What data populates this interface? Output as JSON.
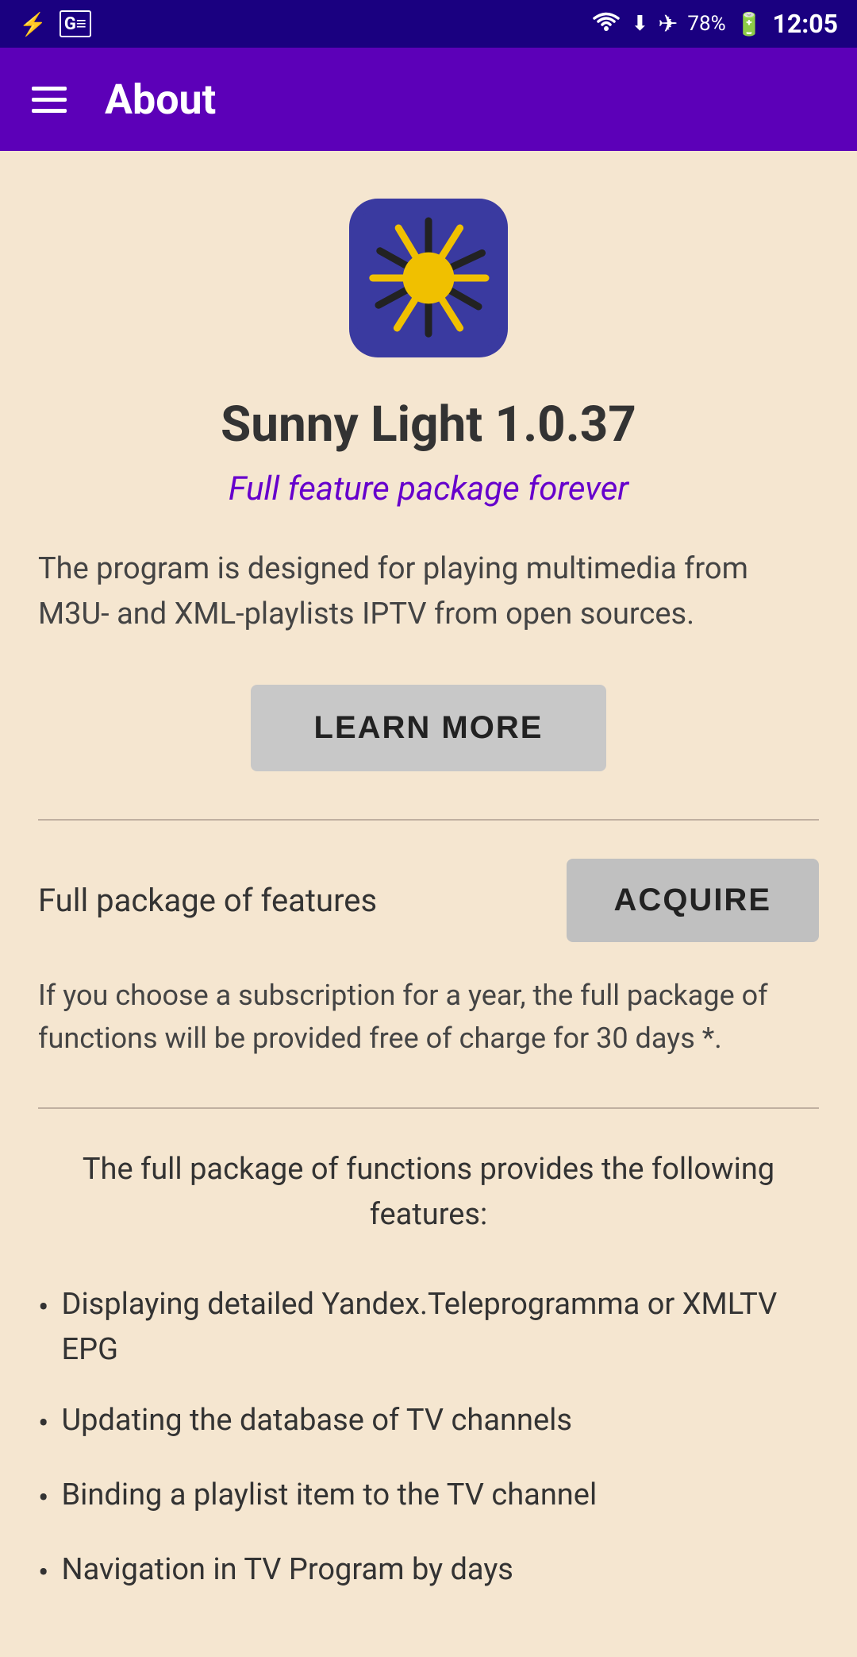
{
  "statusBar": {
    "time": "12:05",
    "battery": "78%",
    "icons": {
      "usb": "⚡",
      "news": "G≡",
      "wifi": "📶",
      "airplane": "✈",
      "charging": "🔋"
    }
  },
  "toolbar": {
    "title": "About",
    "menu_icon": "menu"
  },
  "app": {
    "name": "Sunny Light 1.0.37",
    "tagline": "Full feature package forever",
    "description": "The program is designed for playing multimedia from M3U- and XML-playlists IPTV from open sources.",
    "learn_more_label": "LEARN MORE",
    "acquire_label": "Full package of features",
    "acquire_button": "ACQUIRE",
    "subscription_text": "If you choose a subscription for a year, the full package of functions will be provided free of charge for 30 days *.",
    "features_intro": "The full package of functions provides the following features:",
    "features": [
      "Displaying detailed Yandex.Teleprogramma or XMLTV EPG",
      "Updating the database of TV channels",
      "Binding a playlist item to the TV channel",
      "Navigation in TV Program by days"
    ]
  },
  "colors": {
    "status_bar_bg": "#1a0080",
    "toolbar_bg": "#5c00b8",
    "content_bg": "#f5e6d0",
    "tagline_color": "#6600cc",
    "button_bg": "#c8c8c8",
    "acquire_btn_bg": "#c0c0c0",
    "app_icon_bg": "#3a3aa0"
  }
}
